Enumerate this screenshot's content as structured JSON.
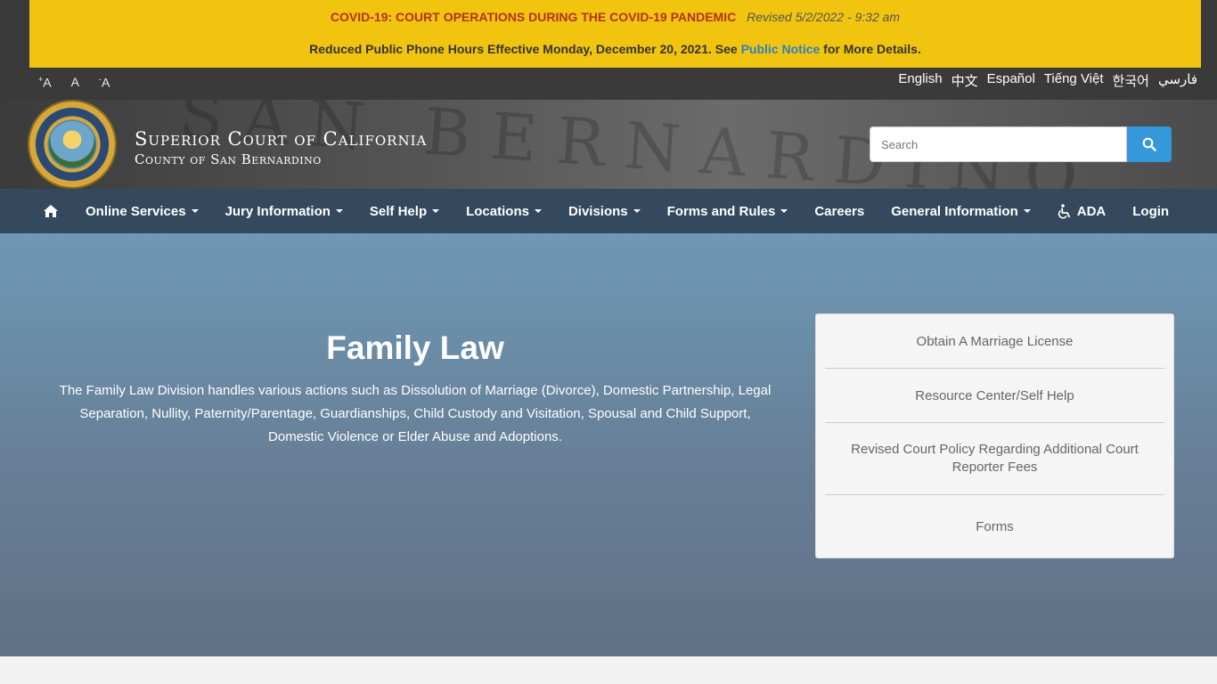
{
  "alert": {
    "title": "COVID-19: COURT OPERATIONS DURING THE COVID-19 PANDEMIC",
    "revised": "Revised 5/2/2022 - 9:32 am",
    "notice_before": "Reduced Public Phone Hours Effective Monday, December 20, 2021. See ",
    "notice_link": "Public Notice",
    "notice_after": " for More Details."
  },
  "font_controls": {
    "increase": "A",
    "normal": "A",
    "decrease": "A"
  },
  "languages": [
    "English",
    "中文",
    "Español",
    "Tiếng Việt",
    "한국어",
    "فارسي"
  ],
  "header": {
    "title": "Superior Court of California",
    "subtitle": "County of San Bernardino"
  },
  "search": {
    "placeholder": "Search"
  },
  "nav": {
    "items": [
      {
        "label": "Online Services",
        "dropdown": true
      },
      {
        "label": "Jury Information",
        "dropdown": true
      },
      {
        "label": "Self Help",
        "dropdown": true
      },
      {
        "label": "Locations",
        "dropdown": true
      },
      {
        "label": "Divisions",
        "dropdown": true
      },
      {
        "label": "Forms and Rules",
        "dropdown": true
      },
      {
        "label": "Careers",
        "dropdown": false
      },
      {
        "label": "General Information",
        "dropdown": true
      },
      {
        "label": "ADA",
        "dropdown": false
      },
      {
        "label": "Login",
        "dropdown": false
      }
    ]
  },
  "hero": {
    "title": "Family Law",
    "description": "The Family Law Division handles various actions such as Dissolution of Marriage (Divorce), Domestic Partnership, Legal Separation, Nullity, Paternity/Parentage, Guardianships, Child Custody and Visitation, Spousal and Child Support, Domestic Violence or Elder Abuse and Adoptions."
  },
  "quick_links": [
    "Obtain A Marriage License",
    "Resource Center/Self Help",
    "Revised Court Policy Regarding Additional Court Reporter Fees",
    "Forms"
  ],
  "colors": {
    "alert_bg": "#f1c40f",
    "alert_title": "#b1341c",
    "nav_bg": "#34495e",
    "search_button": "#3498db"
  }
}
